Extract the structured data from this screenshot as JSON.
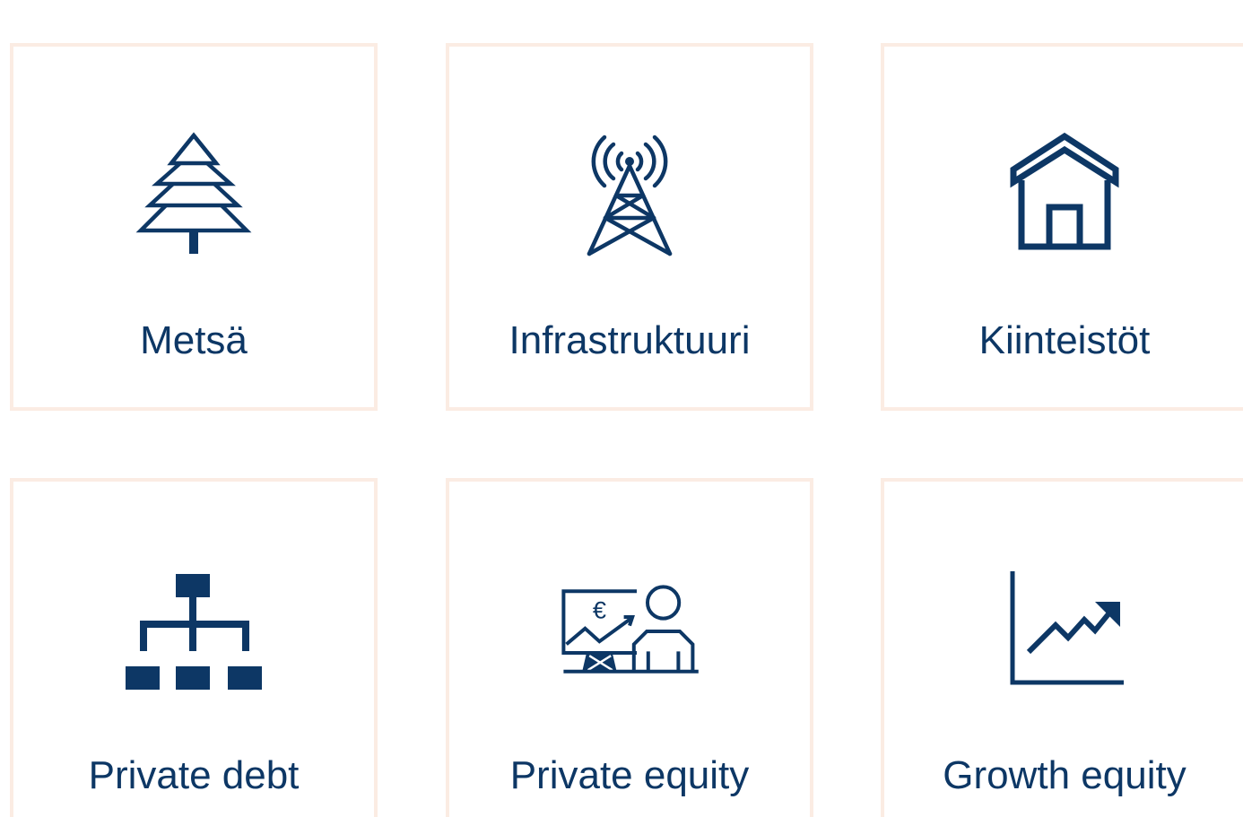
{
  "colors": {
    "brand": "#0d3765",
    "card_border": "#fbece3",
    "background": "#ffffff"
  },
  "cards": [
    {
      "label": "Metsä",
      "icon": "tree-icon"
    },
    {
      "label": "Infrastruktuuri",
      "icon": "radio-tower-icon"
    },
    {
      "label": "Kiinteistöt",
      "icon": "house-icon"
    },
    {
      "label": "Private debt",
      "icon": "org-chart-icon"
    },
    {
      "label": "Private equity",
      "icon": "presentation-euro-icon"
    },
    {
      "label": "Growth equity",
      "icon": "growth-chart-icon"
    }
  ],
  "presentation": {
    "currency_symbol": "€"
  }
}
